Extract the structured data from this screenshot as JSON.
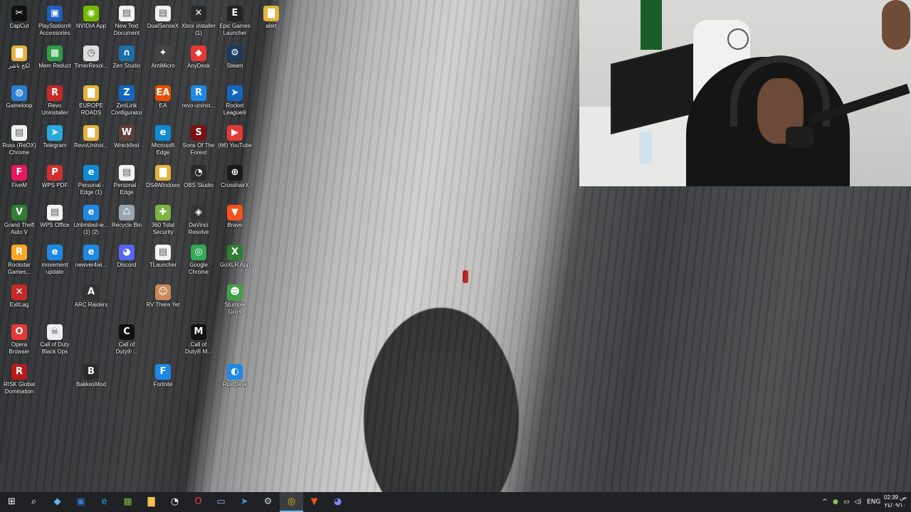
{
  "desktop": {
    "icons": [
      {
        "label": "CapCut",
        "icon": "capcut-icon",
        "color": "#111111",
        "glyph": "✂"
      },
      {
        "label": "PlayStation®\nAccessories",
        "icon": "playstation-icon",
        "color": "#1f5fbf",
        "glyph": "▣"
      },
      {
        "label": "NVIDIA App",
        "icon": "nvidia-icon",
        "color": "#76b900",
        "glyph": "◉"
      },
      {
        "label": "New Text\nDocument",
        "icon": "text-document-icon",
        "color": "#f2f2f2",
        "glyph": "▤"
      },
      {
        "label": "DualSenseX",
        "icon": "file-icon",
        "color": "#f2f2f2",
        "glyph": "▤"
      },
      {
        "label": "Xbox installer\n(1)",
        "icon": "xbox-icon",
        "color": "#2a2a2a",
        "glyph": "✕"
      },
      {
        "label": "Epic Games\nLauncher",
        "icon": "epic-games-icon",
        "color": "#222222",
        "glyph": "E"
      },
      {
        "label": "alert",
        "icon": "folder-icon",
        "color": "#e2b43c",
        "glyph": "▇"
      },
      {
        "label": "لكح باشر",
        "icon": "folder-icon",
        "color": "#e2b43c",
        "glyph": "▇"
      },
      {
        "label": "Mem Reduct",
        "icon": "mem-reduct-icon",
        "color": "#2f9e44",
        "glyph": "▦"
      },
      {
        "label": "TimerResol...",
        "icon": "timer-icon",
        "color": "#dddddd",
        "glyph": "◷"
      },
      {
        "label": "Zen Studio",
        "icon": "zen-studio-icon",
        "color": "#1d6fa5",
        "glyph": "∩"
      },
      {
        "label": "AntiMicro",
        "icon": "gamepad-icon",
        "color": "#444444",
        "glyph": "✦"
      },
      {
        "label": "AnyDesk",
        "icon": "anydesk-icon",
        "color": "#e53935",
        "glyph": "◆"
      },
      {
        "label": "Steam",
        "icon": "steam-icon",
        "color": "#1b3a5c",
        "glyph": "⚙"
      },
      {
        "label": "Gameloop",
        "icon": "gameloop-icon",
        "color": "#2a7fd4",
        "glyph": "◍"
      },
      {
        "label": "Revo\nUninstaller",
        "icon": "revo-icon",
        "color": "#c62828",
        "glyph": "R"
      },
      {
        "label": "EUROPE\nROADS",
        "icon": "folder-icon",
        "color": "#e2b43c",
        "glyph": "▇"
      },
      {
        "label": "ZenLink\nConfigurator",
        "icon": "zenlink-icon",
        "color": "#1565c0",
        "glyph": "Z"
      },
      {
        "label": "EA",
        "icon": "ea-icon",
        "color": "#e65100",
        "glyph": "EA"
      },
      {
        "label": "revo-uninst...",
        "icon": "installer-icon",
        "color": "#1e88e5",
        "glyph": "R"
      },
      {
        "label": "Rocket\nLeague®",
        "icon": "rocket-league-icon",
        "color": "#1565c0",
        "glyph": "➤"
      },
      {
        "label": "Roxx (ReOX)\nChrome",
        "icon": "file-icon",
        "color": "#f2f2f2",
        "glyph": "▤"
      },
      {
        "label": "Telegram",
        "icon": "telegram-icon",
        "color": "#29a8e0",
        "glyph": "➤"
      },
      {
        "label": "RevoUninst...",
        "icon": "folder-icon",
        "color": "#e2b43c",
        "glyph": "▇"
      },
      {
        "label": "Wreckfest",
        "icon": "wreckfest-icon",
        "color": "#5d4037",
        "glyph": "W"
      },
      {
        "label": "Microsoft\nEdge",
        "icon": "edge-icon",
        "color": "#0f8bd6",
        "glyph": "e"
      },
      {
        "label": "Sons Of The\nForest",
        "icon": "sons-of-the-forest-icon",
        "color": "#7b1111",
        "glyph": "S"
      },
      {
        "label": "(66) YouTube",
        "icon": "chrome-shortcut-icon",
        "color": "#e53935",
        "glyph": "▶"
      },
      {
        "label": "FiveM",
        "icon": "fivem-icon",
        "color": "#e8175d",
        "glyph": "F"
      },
      {
        "label": "WPS PDF",
        "icon": "wps-pdf-icon",
        "color": "#d32f2f",
        "glyph": "P"
      },
      {
        "label": "Personal -\nEdge (1)",
        "icon": "edge-icon",
        "color": "#0f8bd6",
        "glyph": "e"
      },
      {
        "label": "Personal -\nEdge",
        "icon": "file-icon",
        "color": "#f2f2f2",
        "glyph": "▤"
      },
      {
        "label": "DS4Windows",
        "icon": "folder-icon",
        "color": "#e2b43c",
        "glyph": "▇"
      },
      {
        "label": "OBS Studio",
        "icon": "obs-icon",
        "color": "#2a2a2a",
        "glyph": "◔"
      },
      {
        "label": "CrosshairX",
        "icon": "crosshair-icon",
        "color": "#1a1a1a",
        "glyph": "⊕"
      },
      {
        "label": "Grand Theft\nAuto V",
        "icon": "gta-icon",
        "color": "#2e7d32",
        "glyph": "V"
      },
      {
        "label": "WPS Office",
        "icon": "file-icon",
        "color": "#f2f2f2",
        "glyph": "▤"
      },
      {
        "label": "Unlimited-ie...\n(1) (2)",
        "icon": "ie-icon",
        "color": "#1e88e5",
        "glyph": "e"
      },
      {
        "label": "Recycle Bin",
        "icon": "recycle-bin-icon",
        "color": "#9aa4ad",
        "glyph": "♺"
      },
      {
        "label": "360 Total\nSecurity",
        "icon": "360-security-icon",
        "color": "#7cb342",
        "glyph": "✚"
      },
      {
        "label": "DaVinci\nResolve",
        "icon": "davinci-icon",
        "color": "#333333",
        "glyph": "◈"
      },
      {
        "label": "Brave",
        "icon": "brave-icon",
        "color": "#f4511e",
        "glyph": "▼"
      },
      {
        "label": "Rockstar\nGames...",
        "icon": "rockstar-icon",
        "color": "#f9a825",
        "glyph": "R"
      },
      {
        "label": "movement\nupdate",
        "icon": "ie-icon",
        "color": "#1e88e5",
        "glyph": "e"
      },
      {
        "label": "newver4wi...",
        "icon": "ie-icon",
        "color": "#1e88e5",
        "glyph": "e"
      },
      {
        "label": "Discord",
        "icon": "discord-icon",
        "color": "#5865f2",
        "glyph": "◕"
      },
      {
        "label": "TLauncher",
        "icon": "file-icon",
        "color": "#f2f2f2",
        "glyph": "▤"
      },
      {
        "label": "Google\nChrome",
        "icon": "chrome-icon",
        "color": "#34a853",
        "glyph": "◎"
      },
      {
        "label": "GoXLR App",
        "icon": "goxlr-icon",
        "color": "#2e7d32",
        "glyph": "X"
      },
      {
        "label": "ExitLag",
        "icon": "exitlag-icon",
        "color": "#c62828",
        "glyph": "✕"
      },
      {
        "label": "ARC Raiders",
        "icon": "arc-raiders-icon",
        "color": "#333333",
        "glyph": "A"
      },
      {
        "label": "RV There Yet",
        "icon": "rv-there-yet-icon",
        "color": "#c98a5b",
        "glyph": "☺"
      },
      {
        "label": "Stumble\nGuys",
        "icon": "stumble-guys-icon",
        "color": "#43a047",
        "glyph": "☻"
      },
      {
        "label": "Opera\nBrowser",
        "icon": "opera-icon",
        "color": "#e53935",
        "glyph": "O"
      },
      {
        "label": "Call of Duty\nBlack Ops",
        "icon": "skull-icon",
        "color": "#eceff1",
        "glyph": "☠"
      },
      {
        "label": "Call of\nDuty® ...",
        "icon": "call-of-duty-icon",
        "color": "#111111",
        "glyph": "C"
      },
      {
        "label": "Call of\nDuty® M...",
        "icon": "call-of-duty-mobile-icon",
        "color": "#111111",
        "glyph": "M"
      },
      {
        "label": "RISK Global\nDomination",
        "icon": "risk-icon",
        "color": "#b71c1c",
        "glyph": "R"
      },
      {
        "label": "BakkesMod",
        "icon": "bakkesmod-icon",
        "color": "#2b2b2b",
        "glyph": "B"
      },
      {
        "label": "Fortnite",
        "icon": "fortnite-icon",
        "color": "#1e88e5",
        "glyph": "F"
      },
      {
        "label": "RustDesk",
        "icon": "rustdesk-icon",
        "color": "#1e88e5",
        "glyph": "◐"
      }
    ]
  },
  "webcam": {
    "label": "webcam-overlay"
  },
  "taskbar": {
    "buttons": [
      {
        "name": "start-button",
        "glyph": "⊞",
        "color": "#ffffff"
      },
      {
        "name": "search-button",
        "glyph": "⌕",
        "color": "#ffffff"
      },
      {
        "name": "copilot-button",
        "glyph": "◆",
        "color": "#6db3f2"
      },
      {
        "name": "store-button",
        "glyph": "▣",
        "color": "#3a78d4"
      },
      {
        "name": "edge-button",
        "glyph": "e",
        "color": "#2aa6e6"
      },
      {
        "name": "calculator-button",
        "glyph": "▦",
        "color": "#7cb342"
      },
      {
        "name": "file-explorer-button",
        "glyph": "▇",
        "color": "#f2c14e"
      },
      {
        "name": "obs-button",
        "glyph": "◔",
        "color": "#ffffff"
      },
      {
        "name": "opera-button",
        "glyph": "O",
        "color": "#ff3b3b"
      },
      {
        "name": "terminal-button",
        "glyph": "▭",
        "color": "#8fb3ff"
      },
      {
        "name": "rocket-league-button",
        "glyph": "➤",
        "color": "#4a90e2"
      },
      {
        "name": "steam-button",
        "glyph": "⚙",
        "color": "#c7d5e0"
      },
      {
        "name": "chrome-button",
        "glyph": "◎",
        "color": "#fbbc05"
      },
      {
        "name": "brave-button",
        "glyph": "▼",
        "color": "#f4511e"
      },
      {
        "name": "discord-button",
        "glyph": "◕",
        "color": "#7c86ff"
      }
    ],
    "tray": {
      "chevron": "^",
      "language": "ENG",
      "time": "02:39 ص",
      "date": "٢٤/٠٩/١٠"
    }
  }
}
